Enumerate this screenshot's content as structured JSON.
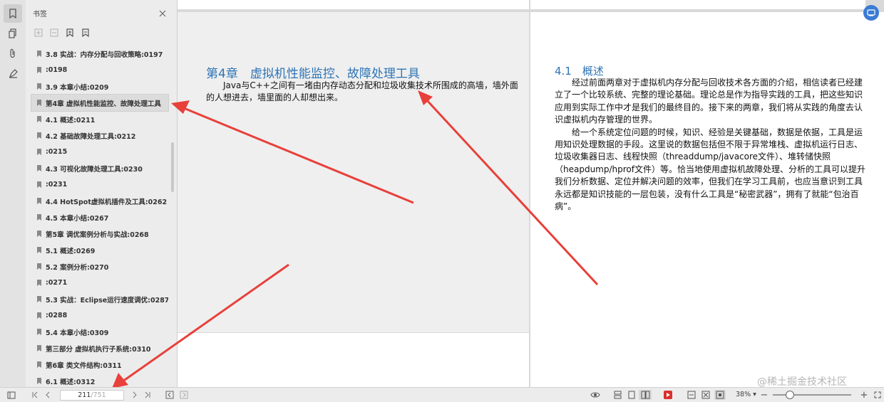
{
  "panel": {
    "title": "书签",
    "items": [
      {
        "label": "3.8 实战：内存分配与回收策略:0197",
        "selected": false
      },
      {
        "label": ":0198",
        "selected": false
      },
      {
        "label": "3.9 本章小结:0209",
        "selected": false
      },
      {
        "label": "第4章 虚拟机性能监控、故障处理工具",
        "selected": true
      },
      {
        "label": "4.1 概述:0211",
        "selected": false
      },
      {
        "label": "4.2 基础故障处理工具:0212",
        "selected": false
      },
      {
        "label": ":0215",
        "selected": false
      },
      {
        "label": "4.3 可视化故障处理工具:0230",
        "selected": false
      },
      {
        "label": ":0231",
        "selected": false
      },
      {
        "label": "4.4 HotSpot虚拟机插件及工具:0262",
        "selected": false
      },
      {
        "label": "4.5 本章小结:0267",
        "selected": false
      },
      {
        "label": "第5章 调优案例分析与实战:0268",
        "selected": false
      },
      {
        "label": "5.1 概述:0269",
        "selected": false
      },
      {
        "label": "5.2 案例分析:0270",
        "selected": false
      },
      {
        "label": ":0271",
        "selected": false
      },
      {
        "label": "5.3 实战：Eclipse运行速度调优:0287",
        "selected": false
      },
      {
        "label": ":0288",
        "selected": false
      },
      {
        "label": "5.4 本章小结:0309",
        "selected": false
      },
      {
        "label": "第三部分 虚拟机执行子系统:0310",
        "selected": false
      },
      {
        "label": "第6章 类文件结构:0311",
        "selected": false
      },
      {
        "label": "6.1 概述:0312",
        "selected": false
      }
    ]
  },
  "page_left": {
    "title": "第4章　虚拟机性能监控、故障处理工具",
    "body": "Java与C++之间有一堵由内存动态分配和垃圾收集技术所围成的高墙，墙外面的人想进去，墙里面的人却想出来。"
  },
  "page_right": {
    "title": "4.1　概述",
    "paragraphs": [
      "经过前面两章对于虚拟机内存分配与回收技术各方面的介绍，相信读者已经建立了一个比较系统、完整的理论基础。理论总是作为指导实践的工具，把这些知识应用到实际工作中才是我们的最终目的。接下来的两章，我们将从实践的角度去认识虚拟机内存管理的世界。",
      "给一个系统定位问题的时候，知识、经验是关键基础，数据是依据，工具是运用知识处理数据的手段。这里说的数据包括但不限于异常堆栈、虚拟机运行日志、垃圾收集器日志、线程快照（threaddump/javacore文件）、堆转储快照（heapdump/hprof文件）等。恰当地使用虚拟机故障处理、分析的工具可以提升我们分析数据、定位并解决问题的效率，但我们在学习工具前，也应当意识到工具永远都是知识技能的一层包装，没有什么工具是“秘密武器”，拥有了就能“包治百病”。"
    ]
  },
  "statusbar": {
    "current_page": "211",
    "total_pages": "/751",
    "zoom": "38%"
  },
  "watermark": "@稀土掘金技术社区",
  "colors": {
    "heading": "#2e74b5",
    "arrow": "#e8403a",
    "accent": "#3a7bd5"
  }
}
